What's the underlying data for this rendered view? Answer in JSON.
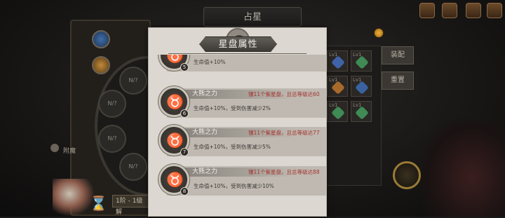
{
  "background": {
    "top_title": "占星",
    "side_label": "附魔",
    "wheel_nodes": [
      "N/?",
      "N/?",
      "N/?",
      "N/?"
    ],
    "slots": [
      "Lv1",
      "Lv1",
      "Lv1",
      "Lv1",
      "Lv1",
      "Lv1"
    ],
    "right_buttons": [
      "装配",
      "重置"
    ],
    "bottom_button": "1阶 - 1级解"
  },
  "dialog": {
    "title": "星盘属性",
    "items": [
      {
        "level": "5",
        "name": "",
        "condition": "",
        "effect": "生命值+10%"
      },
      {
        "level": "6",
        "name": "大熊之力",
        "condition": "镶11个紫星盘，且总等级达60",
        "effect": "生命值+10%，受到伤害减少2%"
      },
      {
        "level": "7",
        "name": "大熊之力",
        "condition": "镶11个紫星盘，且总等级达77",
        "effect": "生命值+10%，受到伤害减少5%"
      },
      {
        "level": "8",
        "name": "大熊之力",
        "condition": "镶11个紫星盘，且总等级达88",
        "effect": "生命值+10%，受到伤害减少10%"
      }
    ]
  },
  "colors": {
    "condition_red": "#a5342f",
    "panel_bg": "#dcd7d0"
  }
}
